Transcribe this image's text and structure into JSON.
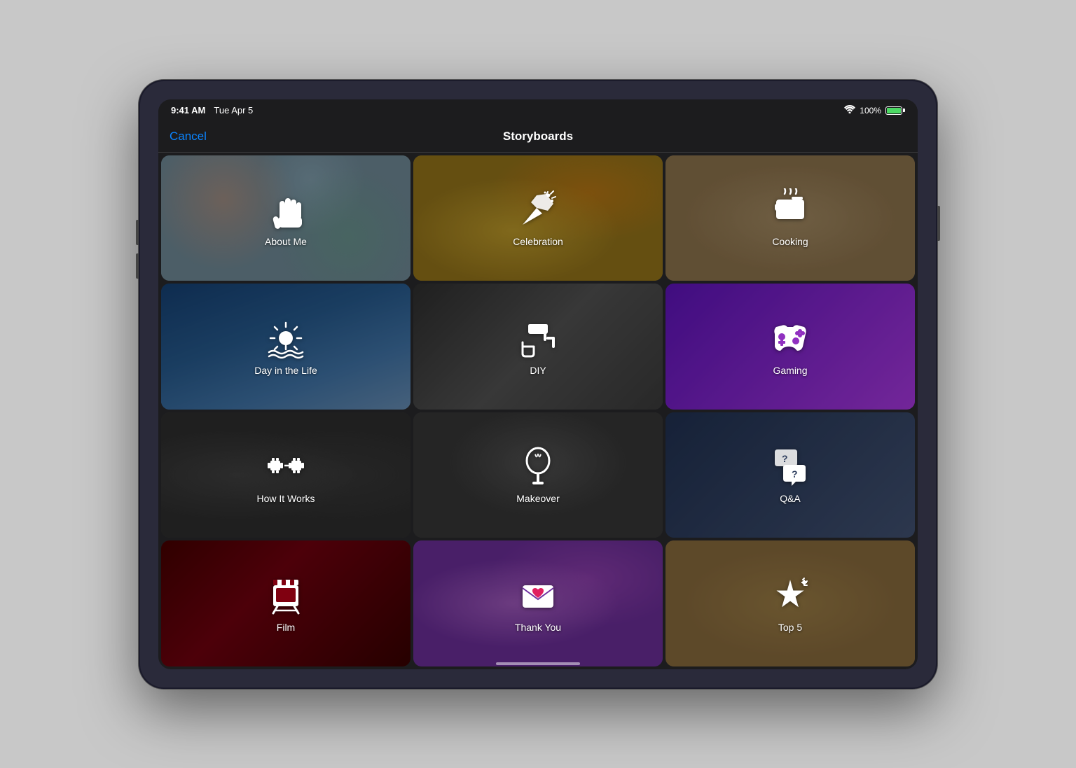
{
  "device": {
    "time": "9:41 AM",
    "date": "Tue Apr 5",
    "battery_pct": "100%",
    "wifi": true
  },
  "nav": {
    "cancel_label": "Cancel",
    "title": "Storyboards"
  },
  "grid": {
    "items": [
      {
        "id": "about-me",
        "label": "About Me",
        "bg_class": "bg-about-me-deco",
        "icon": "wave"
      },
      {
        "id": "celebration",
        "label": "Celebration",
        "bg_class": "bg-celebration-deco",
        "icon": "party"
      },
      {
        "id": "cooking",
        "label": "Cooking",
        "bg_class": "bg-cooking-deco",
        "icon": "cooking"
      },
      {
        "id": "day-in-life",
        "label": "Day in the Life",
        "bg_class": "bg-day-in-life",
        "icon": "sunrise"
      },
      {
        "id": "diy",
        "label": "DIY",
        "bg_class": "bg-diy",
        "icon": "diy"
      },
      {
        "id": "gaming",
        "label": "Gaming",
        "bg_class": "bg-gaming",
        "icon": "gamepad"
      },
      {
        "id": "how-it-works",
        "label": "How It Works",
        "bg_class": "bg-how-it-works",
        "icon": "gears"
      },
      {
        "id": "makeover",
        "label": "Makeover",
        "bg_class": "bg-makeover",
        "icon": "mirror"
      },
      {
        "id": "qa",
        "label": "Q&A",
        "bg_class": "bg-qa",
        "icon": "qa"
      },
      {
        "id": "film",
        "label": "Film",
        "bg_class": "bg-film",
        "icon": "film"
      },
      {
        "id": "thank-you",
        "label": "Thank You",
        "bg_class": "bg-thank-you",
        "icon": "envelope"
      },
      {
        "id": "top5",
        "label": "Top 5",
        "bg_class": "bg-top5",
        "icon": "star"
      }
    ]
  }
}
